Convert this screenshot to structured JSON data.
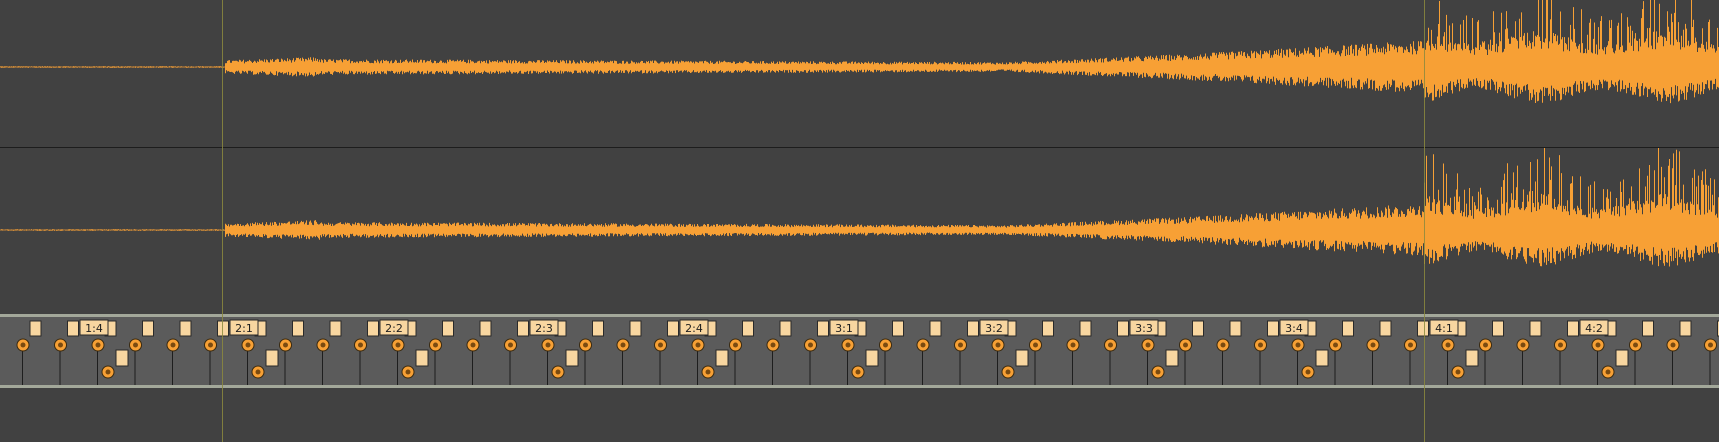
{
  "colors": {
    "background": "#404040",
    "waveform": "#f7a035",
    "marker_fill": "#f8d6a0",
    "strip": "#5b5b5b",
    "guide_line": "#8c8a3e"
  },
  "warp_strip": {
    "beat_labels": [
      "1:4",
      "2:1",
      "2:2",
      "2:3",
      "2:4",
      "3:1",
      "3:2",
      "3:3",
      "3:4",
      "4:1",
      "4:2"
    ]
  }
}
